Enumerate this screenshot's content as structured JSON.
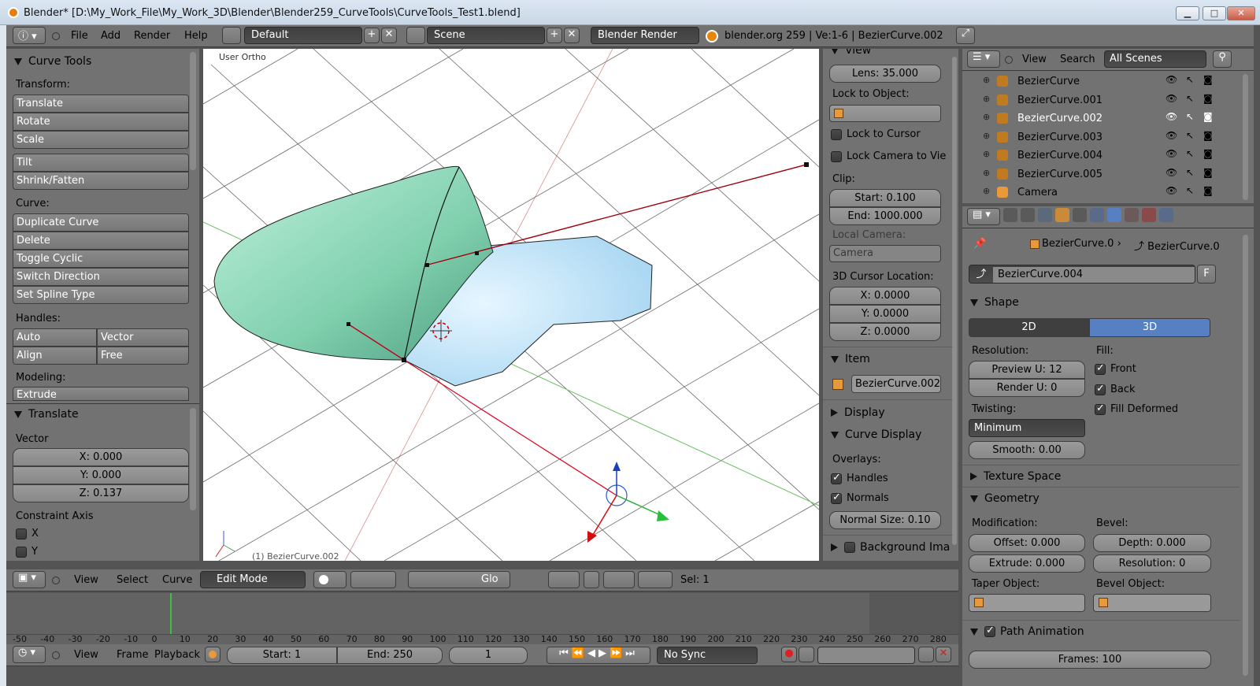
{
  "window": {
    "title": "Blender* [D:\\My_Work_File\\My_Work_3D\\Blender\\Blender259_CurveTools\\CurveTools_Test1.blend]",
    "min": "▁",
    "max": "□",
    "close": "✕"
  },
  "info_header": {
    "menus": [
      "File",
      "Add",
      "Render",
      "Help"
    ],
    "layout": "Default",
    "scene": "Scene",
    "engine": "Blender Render",
    "stats": "blender.org 259 | Ve:1-6 | BezierCurve.002"
  },
  "toolshelf": {
    "title": "Curve Tools",
    "transform_label": "Transform:",
    "transform": [
      "Translate",
      "Rotate",
      "Scale"
    ],
    "tilt": [
      "Tilt",
      "Shrink/Fatten"
    ],
    "curve_label": "Curve:",
    "curve": [
      "Duplicate Curve",
      "Delete",
      "Toggle Cyclic",
      "Switch Direction",
      "Set Spline Type"
    ],
    "handles_label": "Handles:",
    "handles": [
      "Auto",
      "Vector",
      "Align",
      "Free"
    ],
    "modeling_label": "Modeling:",
    "modeling": [
      "Extrude"
    ],
    "op_title": "Translate",
    "vector_label": "Vector",
    "vector": [
      "X: 0.000",
      "Y: 0.000",
      "Z: 0.137"
    ],
    "constraint_label": "Constraint Axis",
    "constraint": [
      "X",
      "Y"
    ]
  },
  "viewport": {
    "label": "User Ortho",
    "object": "(1) BezierCurve.002"
  },
  "properties_n": {
    "view_title": "View",
    "lens": "Lens: 35.000",
    "lock_obj_label": "Lock to Object:",
    "lock_cursor": "Lock to Cursor",
    "lock_camera": "Lock Camera to Vie",
    "clip_label": "Clip:",
    "clip_start": "Start: 0.100",
    "clip_end": "End: 1000.000",
    "local_cam_label": "Local Camera:",
    "local_cam": "Camera",
    "cursor_label": "3D Cursor Location:",
    "cursor": [
      "X: 0.0000",
      "Y: 0.0000",
      "Z: 0.0000"
    ],
    "item_title": "Item",
    "item_name": "BezierCurve.002",
    "display_title": "Display",
    "curve_display_title": "Curve Display",
    "overlays_label": "Overlays:",
    "overlays": [
      "Handles",
      "Normals"
    ],
    "normal_size": "Normal Size: 0.10",
    "background": "Background Ima"
  },
  "view3d_header": {
    "menus": [
      "View",
      "Select",
      "Curve"
    ],
    "mode": "Edit Mode",
    "orientation": "Glo",
    "sel": "Sel: 1"
  },
  "timeline": {
    "ticks": [
      "-50",
      "-40",
      "-30",
      "-20",
      "-10",
      "0",
      "10",
      "20",
      "30",
      "40",
      "50",
      "60",
      "70",
      "80",
      "90",
      "100",
      "110",
      "120",
      "130",
      "140",
      "150",
      "160",
      "170",
      "180",
      "190",
      "200",
      "210",
      "220",
      "230",
      "240",
      "250",
      "260",
      "270",
      "280"
    ],
    "menus": [
      "View",
      "Frame",
      "Playback"
    ],
    "start": "Start: 1",
    "end": "End: 250",
    "current": "1",
    "sync": "No Sync"
  },
  "outliner": {
    "menus": [
      "View",
      "Search"
    ],
    "scenes": "All Scenes",
    "items": [
      "BezierCurve",
      "BezierCurve.001",
      "BezierCurve.002",
      "BezierCurve.003",
      "BezierCurve.004",
      "BezierCurve.005",
      "Camera"
    ]
  },
  "properties": {
    "crumb1": "BezierCurve.0",
    "crumb2": "BezierCurve.0",
    "datablock": "BezierCurve.004",
    "fake": "F",
    "shape_title": "Shape",
    "tab2d": "2D",
    "tab3d": "3D",
    "resolution_label": "Resolution:",
    "preview_u": "Preview U: 12",
    "render_u": "Render U: 0",
    "fill_label": "Fill:",
    "fill": [
      "Front",
      "Back",
      "Fill Deformed"
    ],
    "twisting_label": "Twisting:",
    "twisting": "Minimum",
    "smooth": "Smooth: 0.00",
    "texture_space": "Texture Space",
    "geometry_title": "Geometry",
    "modification_label": "Modification:",
    "offset": "Offset: 0.000",
    "extrude": "Extrude: 0.000",
    "bevel_label": "Bevel:",
    "depth": "Depth: 0.000",
    "bevel_res": "Resolution: 0",
    "taper_label": "Taper Object:",
    "bevel_obj_label": "Bevel Object:",
    "path_anim": "Path Animation",
    "frames": "Frames: 100"
  },
  "colors": {
    "accent": "#5680c2",
    "header": "#727272",
    "viewport": "#ffffff",
    "mesh_green": "#8fd8b4",
    "mesh_blue": "#bfe3f8",
    "handle_red": "#c0001c"
  }
}
